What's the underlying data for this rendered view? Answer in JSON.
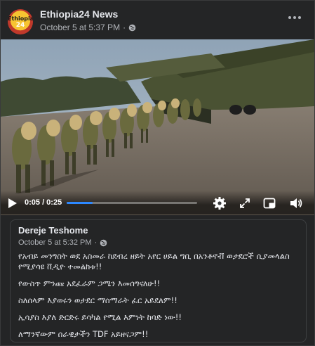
{
  "post": {
    "page_name": "Ethiopia24 News",
    "timestamp": "October 5 at 5:37 PM",
    "separator": "·",
    "avatar_text": "Ethiopia",
    "avatar_num": "24"
  },
  "video": {
    "current_time": "0:05",
    "duration": "0:25",
    "time_display": "0:05 / 0:25",
    "progress_fraction": 0.2,
    "accent_color": "#2d88ff"
  },
  "shared_post": {
    "author": "Dereje Teshome",
    "timestamp": "October 5 at 5:32 PM",
    "separator": "·",
    "paragraphs": [
      "የአብይ መንግስት ወደ አስመራ ከደብረ ዘይት አየር ሀይል ግቢ በአንቶኖቭ ወታደሮች ሲያመላልስ የሚያሳዩ ቪዲዮ ተመልከቱ!!",
      "የውስጥ ምንጩ አደፈራም ጋሜን እመሰግናለሁ!!",
      "ስለሰላም እያወሩን ወታደር ማሰማራት ፈር አይደለም!!",
      "ኢሳያስ እያለ ድርድሩ ይሳካል የሚል እምነት ከባድ ነው!!",
      "ለማንኛውም ሰራዊታችን TDF አይዘናጋም!!"
    ]
  },
  "icons": [
    "globe-icon",
    "more-icon",
    "play-icon",
    "settings-icon",
    "fullscreen-icon",
    "miniplayer-icon",
    "volume-icon"
  ]
}
